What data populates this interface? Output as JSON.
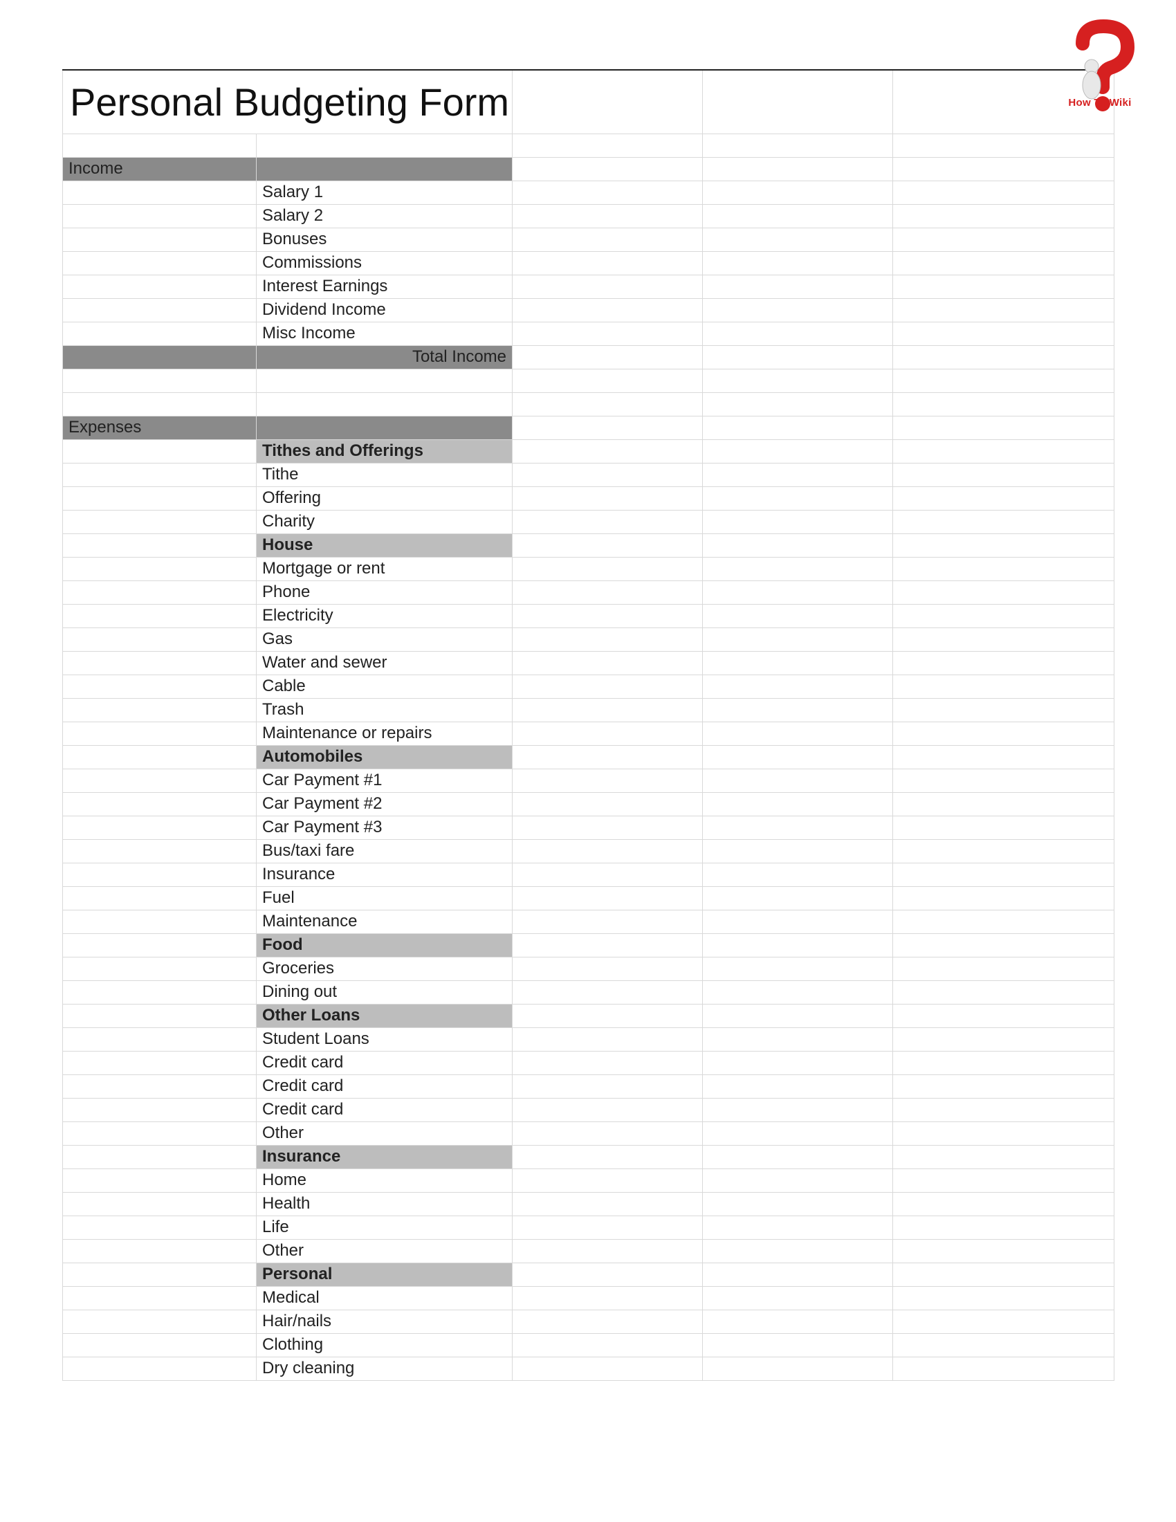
{
  "logo": {
    "brand": "How To Wiki"
  },
  "title": "Personal Budgeting Form",
  "sections": {
    "income": {
      "header": "Income",
      "items": [
        "Salary 1",
        "Salary 2",
        "Bonuses",
        "Commissions",
        "Interest Earnings",
        "Dividend Income",
        "Misc Income"
      ],
      "total_label": "Total Income"
    },
    "expenses": {
      "header": "Expenses",
      "groups": [
        {
          "name": "Tithes and Offerings",
          "items": [
            "Tithe",
            "Offering",
            "Charity"
          ]
        },
        {
          "name": "House",
          "items": [
            "Mortgage or rent",
            "Phone",
            "Electricity",
            "Gas",
            "Water and sewer",
            "Cable",
            "Trash",
            "Maintenance or repairs"
          ]
        },
        {
          "name": "Automobiles",
          "items": [
            "Car Payment #1",
            "Car Payment #2",
            "Car Payment #3",
            "Bus/taxi fare",
            "Insurance",
            "Fuel",
            "Maintenance"
          ]
        },
        {
          "name": "Food",
          "items": [
            "Groceries",
            "Dining out"
          ]
        },
        {
          "name": "Other Loans",
          "items": [
            "Student Loans",
            "Credit card",
            "Credit card",
            "Credit card",
            "Other"
          ]
        },
        {
          "name": "Insurance",
          "items": [
            "Home",
            "Health",
            "Life",
            "Other"
          ]
        },
        {
          "name": "Personal",
          "items": [
            "Medical",
            "Hair/nails",
            "Clothing",
            "Dry cleaning"
          ]
        }
      ]
    }
  }
}
